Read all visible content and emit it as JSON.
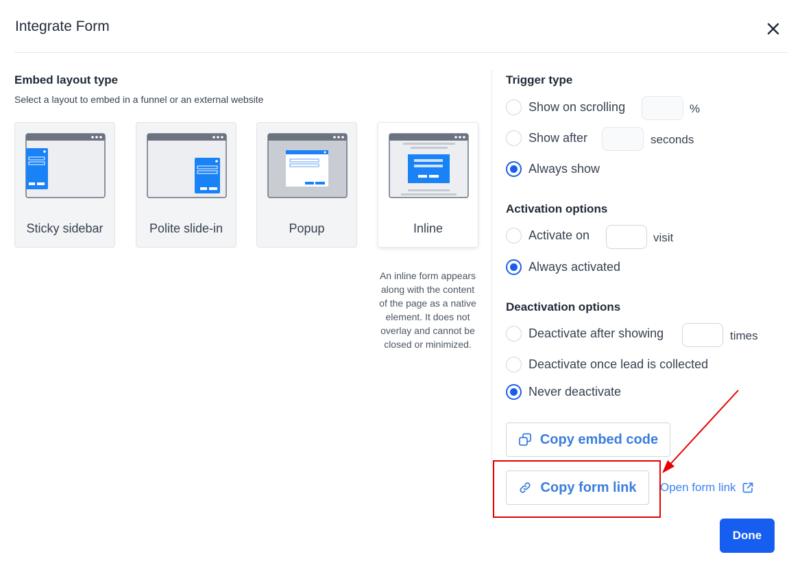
{
  "modal": {
    "title": "Integrate Form"
  },
  "embed": {
    "heading": "Embed layout type",
    "subtitle": "Select a layout to embed in a funnel or an external website",
    "layouts": [
      {
        "label": "Sticky sidebar",
        "icon": "sticky-sidebar-illustration",
        "selected": false
      },
      {
        "label": "Polite slide-in",
        "icon": "polite-slide-in-illustration",
        "selected": false
      },
      {
        "label": "Popup",
        "icon": "popup-illustration",
        "selected": false
      },
      {
        "label": "Inline",
        "icon": "inline-illustration",
        "selected": true
      }
    ],
    "inline_description": "An inline form appears along with the content of the page as a native element. It does not overlay and cannot be closed or minimized."
  },
  "trigger": {
    "heading": "Trigger type",
    "options": [
      {
        "label": "Show on scrolling",
        "unit": "%",
        "value": "",
        "checked": false
      },
      {
        "label": "Show after",
        "unit": "seconds",
        "value": "",
        "checked": false
      },
      {
        "label": "Always show",
        "checked": true
      }
    ]
  },
  "activation": {
    "heading": "Activation options",
    "options": [
      {
        "label": "Activate on",
        "unit": "visit",
        "value": "",
        "checked": false
      },
      {
        "label": "Always activated",
        "checked": true
      }
    ]
  },
  "deactivation": {
    "heading": "Deactivation options",
    "options": [
      {
        "label": "Deactivate after showing",
        "unit": "times",
        "value": "",
        "checked": false
      },
      {
        "label": "Deactivate once lead is collected",
        "checked": false
      },
      {
        "label": "Never deactivate",
        "checked": true
      }
    ]
  },
  "actions": {
    "copy_embed_code": "Copy embed code",
    "copy_form_link": "Copy form link",
    "open_form_link": "Open form link",
    "done": "Done"
  },
  "colors": {
    "primary": "#155eef",
    "link": "#3b82f6",
    "annotation": "#e60000",
    "illustration_blue": "#1a82f7",
    "illustration_gray": "#6b7280"
  }
}
